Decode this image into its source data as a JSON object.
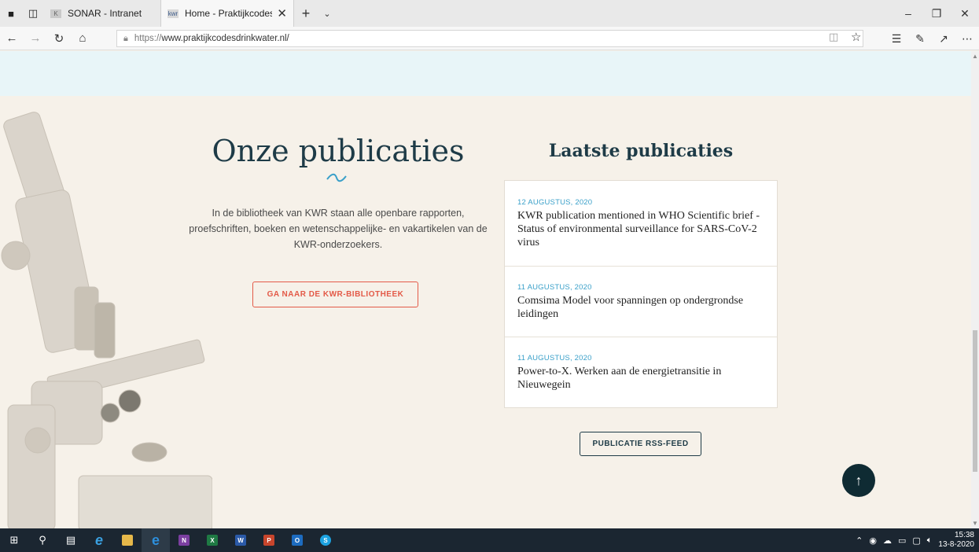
{
  "browser": {
    "tabs": [
      {
        "label": "SONAR - Intranet",
        "active": false
      },
      {
        "label": "Home - Praktijkcodes D",
        "active": true
      }
    ],
    "url_proto": "https://",
    "url_host": "www.praktijkcodesdrinkwater.nl/"
  },
  "page": {
    "heading": "Onze publicaties",
    "intro": "In de bibliotheek van KWR staan alle openbare rapporten, proefschriften, boeken en wetenschappelijke- en vakartikelen van de KWR-onderzoekers.",
    "library_button": "GA NAAR DE KWR-BIBLIOTHEEK",
    "latest_heading": "Laatste publicaties",
    "publications": [
      {
        "date": "12 AUGUSTUS, 2020",
        "title": "KWR publication mentioned in WHO Scientific brief - Status of environmental surveillance for SARS-CoV-2 virus"
      },
      {
        "date": "11 AUGUSTUS, 2020",
        "title": "Comsima Model voor spanningen op ondergrondse leidingen"
      },
      {
        "date": "11 AUGUSTUS, 2020",
        "title": "Power-to-X. Werken aan de energietransitie in Nieuwegein"
      }
    ],
    "rss_button": "PUBLICATIE RSS-FEED",
    "to_top_icon": "arrow-up-icon"
  },
  "taskbar": {
    "time": "15:38",
    "date": "13-8-2020"
  },
  "colors": {
    "accent_red": "#e35a48",
    "dark_teal": "#1e3b47",
    "date_blue": "#3aa0c9",
    "page_bg": "#f6f1e9",
    "top_band": "#e8f5f8"
  }
}
